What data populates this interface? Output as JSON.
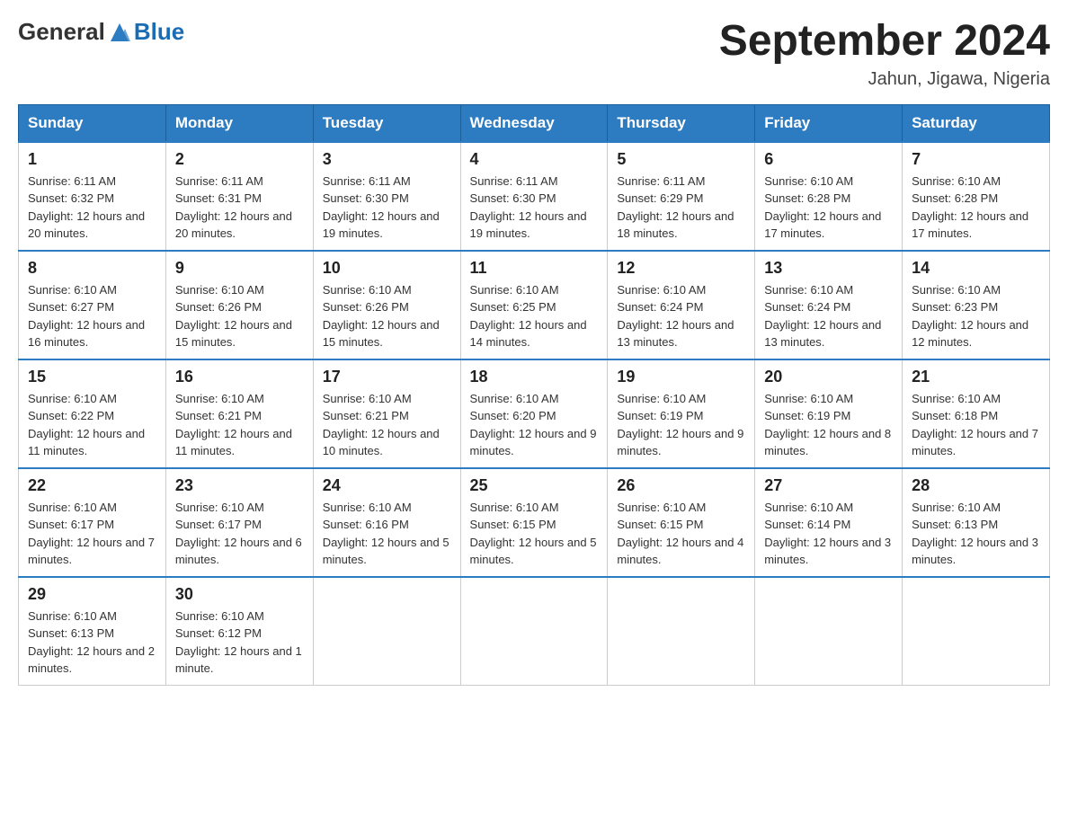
{
  "header": {
    "logo_general": "General",
    "logo_blue": "Blue",
    "month_title": "September 2024",
    "location": "Jahun, Jigawa, Nigeria"
  },
  "weekdays": [
    "Sunday",
    "Monday",
    "Tuesday",
    "Wednesday",
    "Thursday",
    "Friday",
    "Saturday"
  ],
  "weeks": [
    [
      {
        "day": "1",
        "sunrise": "6:11 AM",
        "sunset": "6:32 PM",
        "daylight": "12 hours and 20 minutes."
      },
      {
        "day": "2",
        "sunrise": "6:11 AM",
        "sunset": "6:31 PM",
        "daylight": "12 hours and 20 minutes."
      },
      {
        "day": "3",
        "sunrise": "6:11 AM",
        "sunset": "6:30 PM",
        "daylight": "12 hours and 19 minutes."
      },
      {
        "day": "4",
        "sunrise": "6:11 AM",
        "sunset": "6:30 PM",
        "daylight": "12 hours and 19 minutes."
      },
      {
        "day": "5",
        "sunrise": "6:11 AM",
        "sunset": "6:29 PM",
        "daylight": "12 hours and 18 minutes."
      },
      {
        "day": "6",
        "sunrise": "6:10 AM",
        "sunset": "6:28 PM",
        "daylight": "12 hours and 17 minutes."
      },
      {
        "day": "7",
        "sunrise": "6:10 AM",
        "sunset": "6:28 PM",
        "daylight": "12 hours and 17 minutes."
      }
    ],
    [
      {
        "day": "8",
        "sunrise": "6:10 AM",
        "sunset": "6:27 PM",
        "daylight": "12 hours and 16 minutes."
      },
      {
        "day": "9",
        "sunrise": "6:10 AM",
        "sunset": "6:26 PM",
        "daylight": "12 hours and 15 minutes."
      },
      {
        "day": "10",
        "sunrise": "6:10 AM",
        "sunset": "6:26 PM",
        "daylight": "12 hours and 15 minutes."
      },
      {
        "day": "11",
        "sunrise": "6:10 AM",
        "sunset": "6:25 PM",
        "daylight": "12 hours and 14 minutes."
      },
      {
        "day": "12",
        "sunrise": "6:10 AM",
        "sunset": "6:24 PM",
        "daylight": "12 hours and 13 minutes."
      },
      {
        "day": "13",
        "sunrise": "6:10 AM",
        "sunset": "6:24 PM",
        "daylight": "12 hours and 13 minutes."
      },
      {
        "day": "14",
        "sunrise": "6:10 AM",
        "sunset": "6:23 PM",
        "daylight": "12 hours and 12 minutes."
      }
    ],
    [
      {
        "day": "15",
        "sunrise": "6:10 AM",
        "sunset": "6:22 PM",
        "daylight": "12 hours and 11 minutes."
      },
      {
        "day": "16",
        "sunrise": "6:10 AM",
        "sunset": "6:21 PM",
        "daylight": "12 hours and 11 minutes."
      },
      {
        "day": "17",
        "sunrise": "6:10 AM",
        "sunset": "6:21 PM",
        "daylight": "12 hours and 10 minutes."
      },
      {
        "day": "18",
        "sunrise": "6:10 AM",
        "sunset": "6:20 PM",
        "daylight": "12 hours and 9 minutes."
      },
      {
        "day": "19",
        "sunrise": "6:10 AM",
        "sunset": "6:19 PM",
        "daylight": "12 hours and 9 minutes."
      },
      {
        "day": "20",
        "sunrise": "6:10 AM",
        "sunset": "6:19 PM",
        "daylight": "12 hours and 8 minutes."
      },
      {
        "day": "21",
        "sunrise": "6:10 AM",
        "sunset": "6:18 PM",
        "daylight": "12 hours and 7 minutes."
      }
    ],
    [
      {
        "day": "22",
        "sunrise": "6:10 AM",
        "sunset": "6:17 PM",
        "daylight": "12 hours and 7 minutes."
      },
      {
        "day": "23",
        "sunrise": "6:10 AM",
        "sunset": "6:17 PM",
        "daylight": "12 hours and 6 minutes."
      },
      {
        "day": "24",
        "sunrise": "6:10 AM",
        "sunset": "6:16 PM",
        "daylight": "12 hours and 5 minutes."
      },
      {
        "day": "25",
        "sunrise": "6:10 AM",
        "sunset": "6:15 PM",
        "daylight": "12 hours and 5 minutes."
      },
      {
        "day": "26",
        "sunrise": "6:10 AM",
        "sunset": "6:15 PM",
        "daylight": "12 hours and 4 minutes."
      },
      {
        "day": "27",
        "sunrise": "6:10 AM",
        "sunset": "6:14 PM",
        "daylight": "12 hours and 3 minutes."
      },
      {
        "day": "28",
        "sunrise": "6:10 AM",
        "sunset": "6:13 PM",
        "daylight": "12 hours and 3 minutes."
      }
    ],
    [
      {
        "day": "29",
        "sunrise": "6:10 AM",
        "sunset": "6:13 PM",
        "daylight": "12 hours and 2 minutes."
      },
      {
        "day": "30",
        "sunrise": "6:10 AM",
        "sunset": "6:12 PM",
        "daylight": "12 hours and 1 minute."
      },
      null,
      null,
      null,
      null,
      null
    ]
  ],
  "labels": {
    "sunrise_prefix": "Sunrise: ",
    "sunset_prefix": "Sunset: ",
    "daylight_prefix": "Daylight: "
  }
}
